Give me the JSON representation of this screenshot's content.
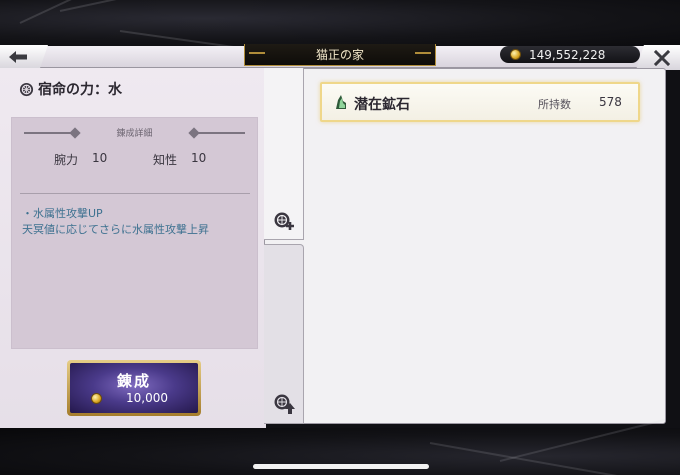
{
  "header": {
    "title": "猫正の家",
    "currency_amount": "149,552,228",
    "currency_icon": "gil-coin-icon"
  },
  "left": {
    "section_title": "宿命の力：水",
    "detail_heading": "錬成詳細",
    "stats": [
      {
        "label": "腕力",
        "value": "10"
      },
      {
        "label": "知性",
        "value": "10"
      }
    ],
    "effect_line1": "・水属性攻撃UP",
    "effect_line2": "天冥値に応じてさらに水属性攻撃上昇",
    "refine_button": {
      "label": "錬成",
      "cost": "10,000"
    }
  },
  "right": {
    "item": {
      "name": "潜在鉱石",
      "qty_label": "所持数",
      "qty": "578"
    }
  },
  "colors": {
    "panel_bg": "#efe9f0",
    "detail_bg": "#d4c8d5",
    "effect_text": "#3d7190",
    "card_border": "#efd78a",
    "button_gold": "#c9a24a",
    "button_purple": "#4a3a8a"
  }
}
